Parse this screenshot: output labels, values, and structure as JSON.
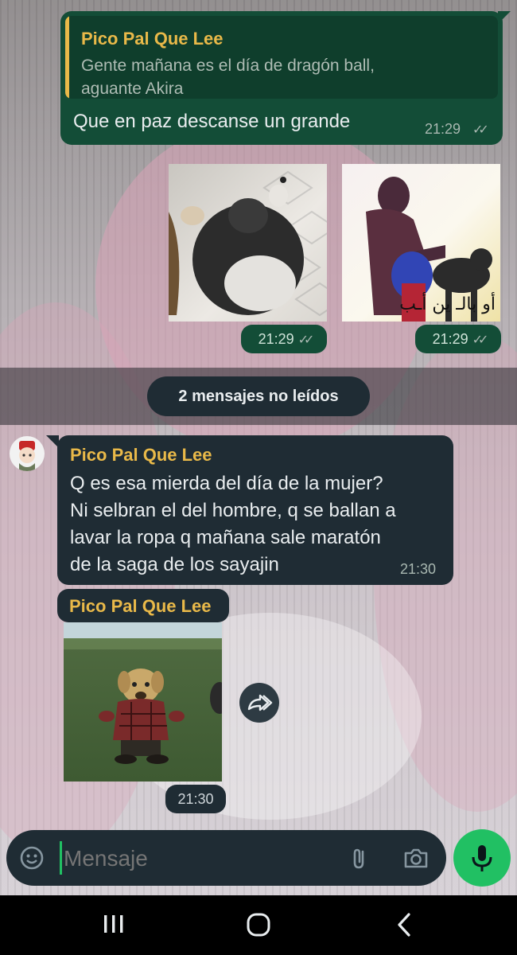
{
  "messages": {
    "outgoing_text": {
      "quote_author": "Pico Pal Que Lee",
      "quote_line1": "Gente mañana es el día de dragón ball,",
      "quote_line2": "aguante Akira",
      "text": "Que en paz descanse un grande",
      "time": "21:29",
      "ticks": "✓✓"
    },
    "outgoing_media_1": {
      "time": "21:29",
      "ticks": "✓✓"
    },
    "outgoing_media_2": {
      "time": "21:29",
      "ticks": "✓✓",
      "overlay_text": "أو بالـ ين أـب"
    },
    "incoming_text": {
      "author": "Pico Pal Que Lee",
      "line1": "Q es esa mierda del día de la mujer?",
      "line2": "Ni selbran el del hombre, q se ballan a",
      "line3": "lavar la ropa q mañana sale maratón",
      "line4": "de la saga de los sayajin",
      "time": "21:30"
    },
    "incoming_media": {
      "author": "Pico Pal Que Lee",
      "time": "21:30"
    }
  },
  "unread_banner": "2 mensajes no leídos",
  "composer": {
    "placeholder": "Mensaje",
    "icons": [
      "sticker-icon",
      "attach-icon",
      "camera-icon",
      "microphone-icon"
    ]
  },
  "colors": {
    "outgoing_bubble": "#134d37",
    "incoming_bubble": "#1f2c34",
    "author_name": "#e9b949",
    "mic_button": "#21c063"
  }
}
